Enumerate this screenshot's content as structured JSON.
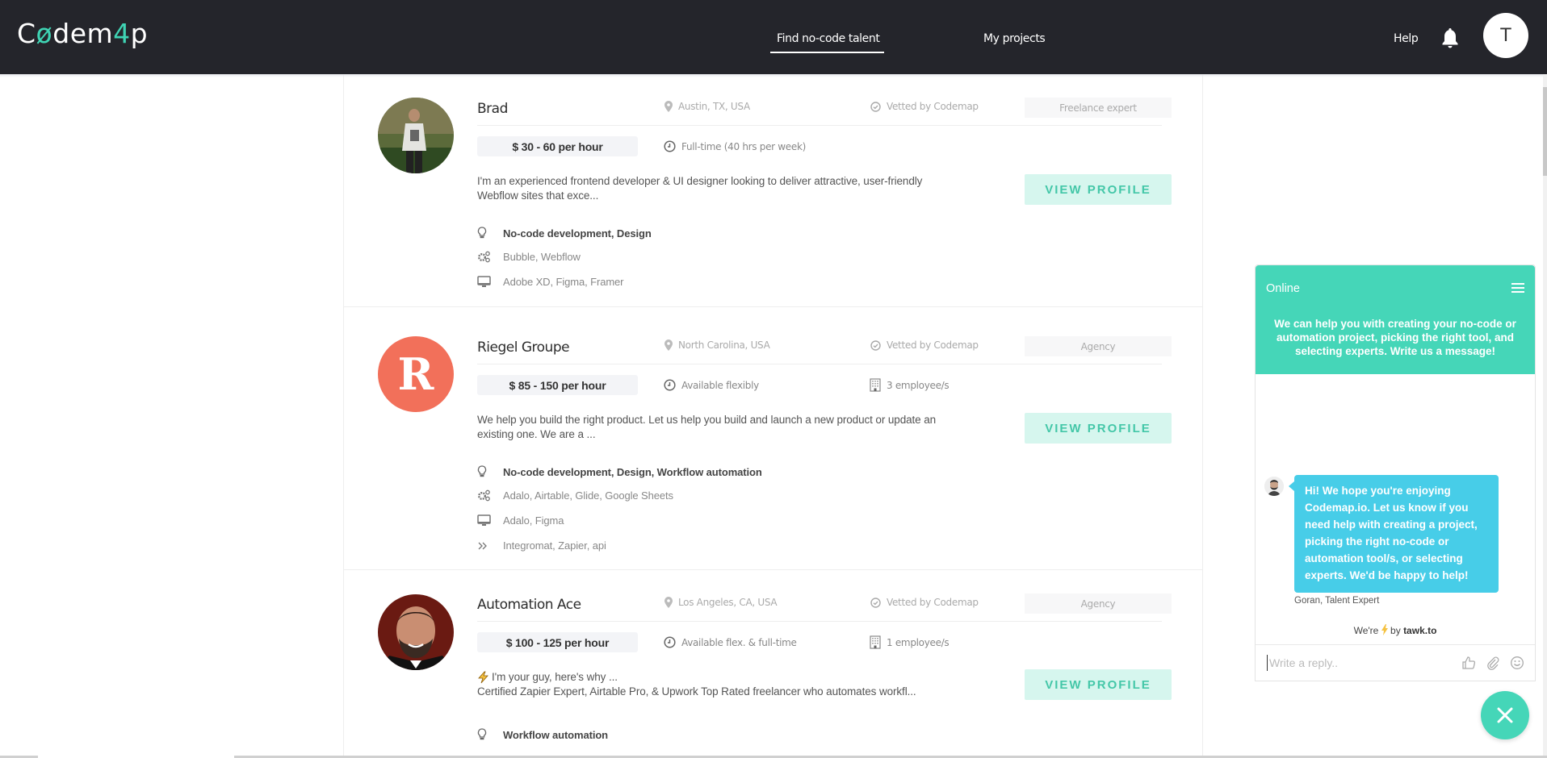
{
  "header": {
    "logo": {
      "part1": "C",
      "part2": "ø",
      "part3": "dem",
      "part4": "4",
      "part5": "p"
    },
    "nav": [
      {
        "label": "Find no-code talent",
        "active": true
      },
      {
        "label": "My projects",
        "active": false
      }
    ],
    "help": "Help",
    "user_initial": "T"
  },
  "colors": {
    "brand": "#3fd4b4",
    "header_bg": "#24252b",
    "button_bg": "#d6f6ee",
    "button_text": "#44c7a8",
    "chat_accent": "#45d6b8",
    "bubble": "#47cde8",
    "avatar_r": "#f2705a"
  },
  "talents": [
    {
      "name": "Brad",
      "location": "Austin, TX, USA",
      "vetted": "Vetted by Codemap",
      "type": "Freelance expert",
      "rate": "$ 30 - 60 per hour",
      "availability": "Full-time (40 hrs per week)",
      "employees": null,
      "description_lines": [
        "I'm an experienced frontend developer & UI designer looking to deliver attractive, user-friendly",
        "Webflow sites that exce..."
      ],
      "view_label": "VIEW PROFILE",
      "skills": [
        {
          "icon": "lightbulb-icon",
          "text": "No-code development, Design",
          "bold": true
        },
        {
          "icon": "gears-icon",
          "text": "Bubble, Webflow",
          "bold": false
        },
        {
          "icon": "monitor-icon",
          "text": "Adobe XD, Figma, Framer",
          "bold": false
        }
      ]
    },
    {
      "name": "Riegel Groupe",
      "avatar_letter": "R",
      "location": "North Carolina, USA",
      "vetted": "Vetted by Codemap",
      "type": "Agency",
      "rate": "$ 85 - 150 per hour",
      "availability": "Available flexibly",
      "employees": "3 employee/s",
      "description_lines": [
        "We help you build the right product. Let us help you build and launch a new product or update an",
        "existing one. We are a ..."
      ],
      "view_label": "VIEW PROFILE",
      "skills": [
        {
          "icon": "lightbulb-icon",
          "text": "No-code development, Design, Workflow automation",
          "bold": true
        },
        {
          "icon": "gears-icon",
          "text": "Adalo, Airtable, Glide, Google Sheets",
          "bold": false
        },
        {
          "icon": "monitor-icon",
          "text": "Adalo, Figma",
          "bold": false
        },
        {
          "icon": "double-chevron-icon",
          "text": "Integromat, Zapier, api",
          "bold": false
        }
      ]
    },
    {
      "name": "Automation Ace",
      "location": "Los Angeles, CA, USA",
      "vetted": "Vetted by Codemap",
      "type": "Agency",
      "rate": "$ 100 - 125 per hour",
      "availability": "Available flex. & full-time",
      "employees": "1 employee/s",
      "description_lines": [
        "I'm your guy, here's why ...",
        "Certified Zapier Expert, Airtable Pro, & Upwork Top Rated freelancer who automates workfl..."
      ],
      "view_label": "VIEW PROFILE",
      "skills": [
        {
          "icon": "lightbulb-icon",
          "text": "Workflow automation",
          "bold": true
        }
      ]
    }
  ],
  "chat": {
    "status": "Online",
    "intro": "We can help you with creating your no-code or automation project, picking the right tool, and selecting experts. Write us a message!",
    "message": "Hi! We hope you're enjoying Codemap.io. Let us know if you need help with creating a project, picking the right no-code or automation tool/s, or selecting experts. We'd be happy to help!",
    "signature": "Goran, Talent Expert",
    "powered_prefix": "We're",
    "powered_by": "by",
    "powered_brand": "tawk.to",
    "reply_placeholder": "Write a reply.."
  }
}
